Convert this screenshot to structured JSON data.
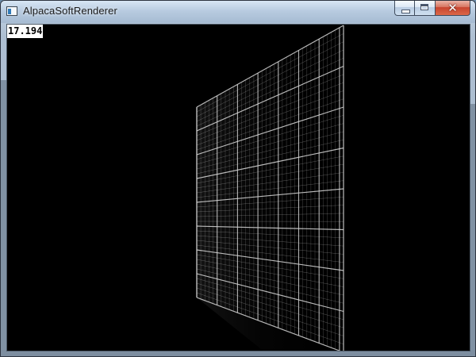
{
  "window": {
    "title": "AlpacaSoftRenderer",
    "controls": {
      "minimize": "minimize",
      "maximize": "maximize",
      "close": "close"
    },
    "icon": "app-window-icon"
  },
  "viewport": {
    "fps": "17.194",
    "background": "#000000",
    "grid_color": "#d9d9d9"
  }
}
